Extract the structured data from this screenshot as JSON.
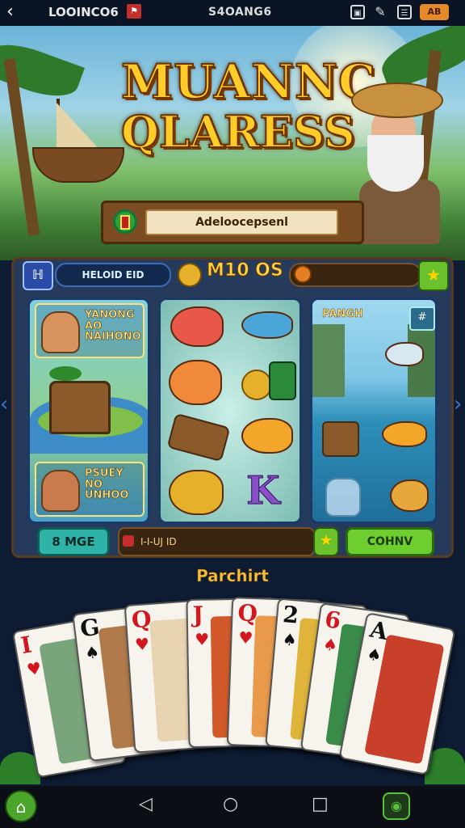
{
  "topbar": {
    "app_title": "LOOINCO6",
    "center_text": "S4OANG6",
    "coin_label": "AB"
  },
  "header": {
    "title_line1": "MUANNC",
    "title_line2": "QLARESS",
    "banner_text": "Adeloocepsenl"
  },
  "slot": {
    "level_label": "HELOID EID",
    "score": "M10 OS",
    "panel1": {
      "tag1": "YANONG AO NAIHONO",
      "tag2": "PSUEY NO UNHOO"
    },
    "panel3": {
      "title": "PANGH",
      "icon": "#"
    }
  },
  "controls": {
    "more_label": "8 MGE",
    "bet_text": "I-I-UJ  ID",
    "go_label": "COHNV"
  },
  "cards": {
    "heading": "Parchirt",
    "items": [
      {
        "rank": "I",
        "suit": "♥",
        "color": "red",
        "art": "#7aa47a"
      },
      {
        "rank": "G",
        "suit": "♠",
        "color": "blk",
        "art": "#b07a4a"
      },
      {
        "rank": "Q",
        "suit": "♥",
        "color": "red",
        "art": "#e8d4b0"
      },
      {
        "rank": "J",
        "suit": "♥",
        "color": "red",
        "art": "#d25a2a"
      },
      {
        "rank": "Q",
        "suit": "♥",
        "color": "red",
        "art": "#e89a4a"
      },
      {
        "rank": "2",
        "suit": "♠",
        "color": "blk",
        "art": "#e0b43a"
      },
      {
        "rank": "6",
        "suit": "♠",
        "color": "red",
        "art": "#3a8a4a"
      },
      {
        "rank": "A",
        "suit": "♠",
        "color": "blk",
        "art": "#c8402a"
      }
    ]
  },
  "colors": {
    "accent_gold": "#ffcc2a",
    "frame_blue": "#263a5c",
    "button_green": "#6fce2f"
  }
}
